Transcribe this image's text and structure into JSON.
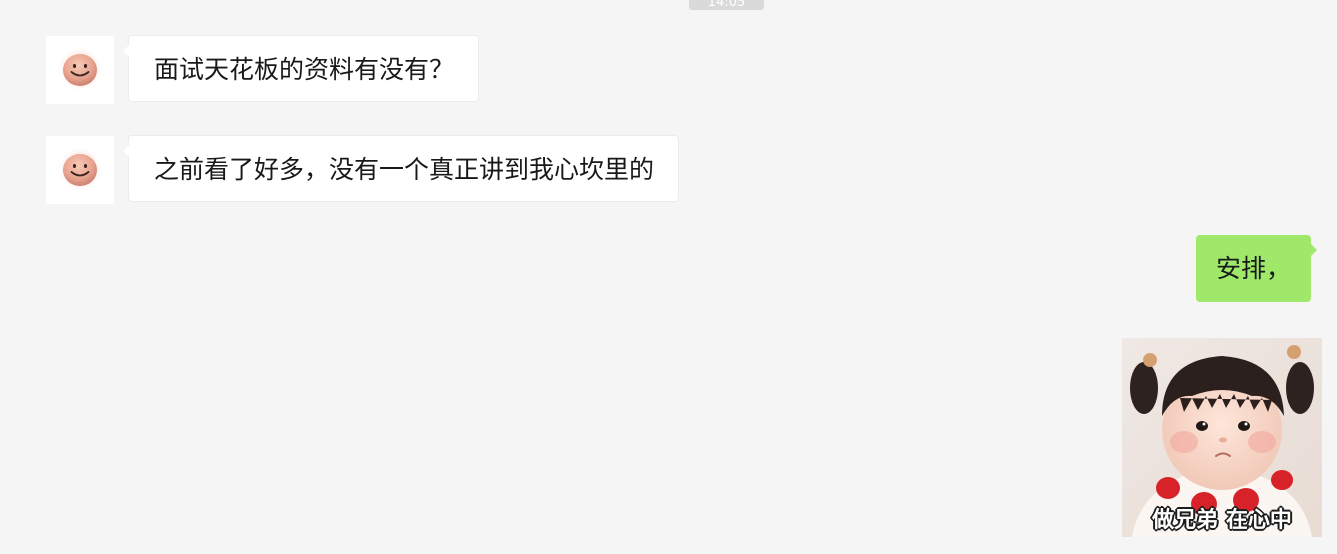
{
  "timestamp": "14:05",
  "messages": [
    {
      "direction": "incoming",
      "avatar_icon": "smiley-face-icon",
      "text": "面试天花板的资料有没有？"
    },
    {
      "direction": "incoming",
      "avatar_icon": "smiley-face-icon",
      "text": "之前看了好多，没有一个真正讲到我心坎里的"
    },
    {
      "direction": "outgoing",
      "text": "安排，"
    },
    {
      "direction": "outgoing",
      "type": "sticker",
      "caption": "做兄弟 在心中",
      "image_icon": "girl-sticker-image"
    }
  ],
  "colors": {
    "background": "#f5f5f5",
    "incoming_bubble": "#ffffff",
    "outgoing_bubble": "#9fe86a",
    "avatar_face": "#e8a38f"
  }
}
